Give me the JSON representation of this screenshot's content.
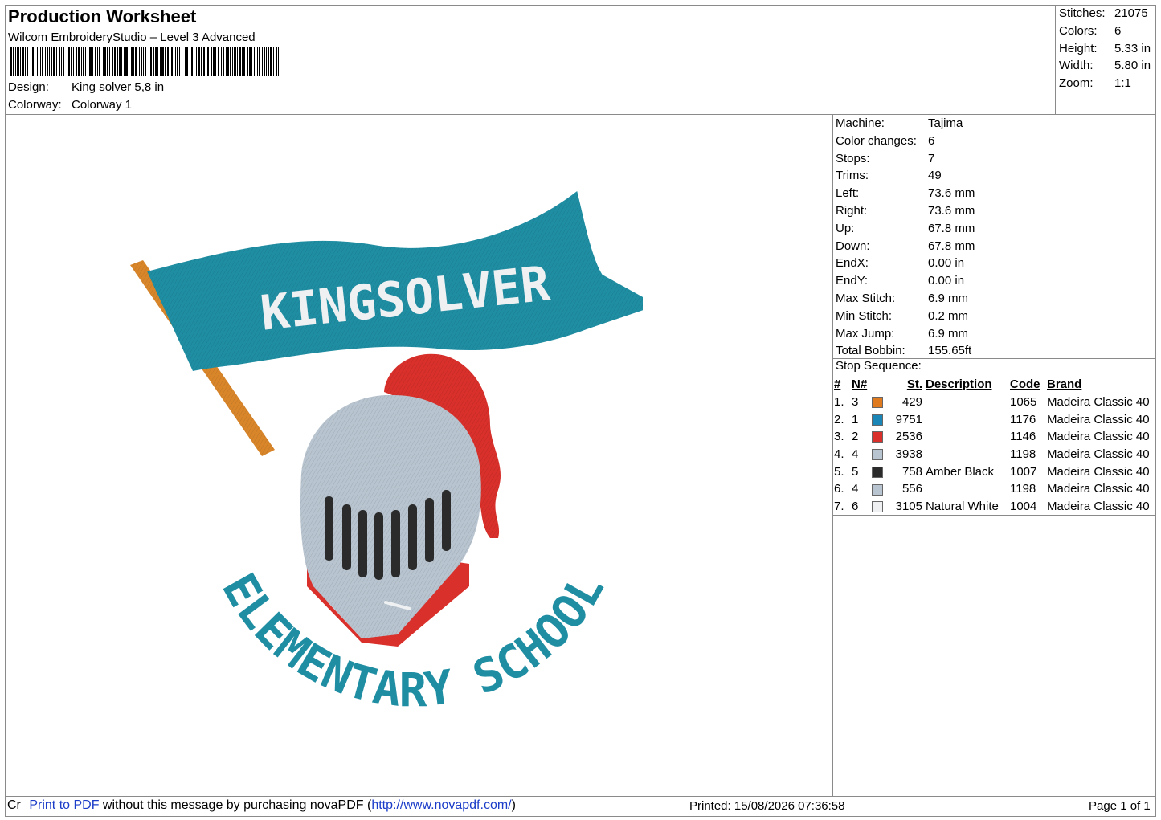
{
  "header": {
    "title": "Production Worksheet",
    "software": "Wilcom EmbroideryStudio – Level 3 Advanced",
    "design_label": "Design:",
    "design_value": "King solver 5,8 in",
    "colorway_label": "Colorway:",
    "colorway_value": "Colorway 1"
  },
  "summary": [
    {
      "label": "Stitches:",
      "value": "21075"
    },
    {
      "label": "Colors:",
      "value": "6"
    },
    {
      "label": "Height:",
      "value": "5.33 in"
    },
    {
      "label": "Width:",
      "value": "5.80 in"
    },
    {
      "label": "Zoom:",
      "value": "1:1"
    }
  ],
  "machine_info": [
    {
      "label": "Machine:",
      "value": "Tajima"
    },
    {
      "label": "Color changes:",
      "value": "6"
    },
    {
      "label": "Stops:",
      "value": "7"
    },
    {
      "label": "Trims:",
      "value": "49"
    },
    {
      "label": "Left:",
      "value": "73.6 mm"
    },
    {
      "label": "Right:",
      "value": "73.6 mm"
    },
    {
      "label": "Up:",
      "value": "67.8 mm"
    },
    {
      "label": "Down:",
      "value": "67.8 mm"
    },
    {
      "label": "EndX:",
      "value": "0.00 in"
    },
    {
      "label": "EndY:",
      "value": "0.00 in"
    },
    {
      "label": "Max Stitch:",
      "value": "6.9 mm"
    },
    {
      "label": "Min Stitch:",
      "value": "0.2 mm"
    },
    {
      "label": "Max Jump:",
      "value": "6.9 mm"
    },
    {
      "label": "Total Bobbin:",
      "value": "155.65ft"
    }
  ],
  "stop_sequence": {
    "title": "Stop Sequence:",
    "columns": [
      "#",
      "N#",
      "St.",
      "Description",
      "Code",
      "Brand"
    ],
    "rows": [
      {
        "num": "1.",
        "n": "3",
        "color": "#e07a1f",
        "st": "429",
        "desc": "",
        "code": "1065",
        "brand": "Madeira Classic 40"
      },
      {
        "num": "2.",
        "n": "1",
        "color": "#1a86b8",
        "st": "9751",
        "desc": "",
        "code": "1176",
        "brand": "Madeira Classic 40"
      },
      {
        "num": "3.",
        "n": "2",
        "color": "#d9302b",
        "st": "2536",
        "desc": "",
        "code": "1146",
        "brand": "Madeira Classic 40"
      },
      {
        "num": "4.",
        "n": "4",
        "color": "#b8c4cf",
        "st": "3938",
        "desc": "",
        "code": "1198",
        "brand": "Madeira Classic 40"
      },
      {
        "num": "5.",
        "n": "5",
        "color": "#2b2b2b",
        "st": "758",
        "desc": "Amber Black",
        "code": "1007",
        "brand": "Madeira Classic 40"
      },
      {
        "num": "6.",
        "n": "4",
        "color": "#b8c4cf",
        "st": "556",
        "desc": "",
        "code": "1198",
        "brand": "Madeira Classic 40"
      },
      {
        "num": "7.",
        "n": "6",
        "color": "#eef0f2",
        "st": "3105",
        "desc": "Natural White",
        "code": "1004",
        "brand": "Madeira Classic 40"
      }
    ]
  },
  "design_text": {
    "banner": "KINGSOLVER",
    "arc": "ELEMENTARY SCHOOL"
  },
  "footer": {
    "prefix": "Cr",
    "link1": "Print to PDF",
    "middle": " without this message by purchasing novaPDF (",
    "link2": "http://www.novapdf.com/",
    "suffix": ")",
    "printed": "Printed: 15/08/2026 07:36:58",
    "page": "Page 1 of 1"
  }
}
